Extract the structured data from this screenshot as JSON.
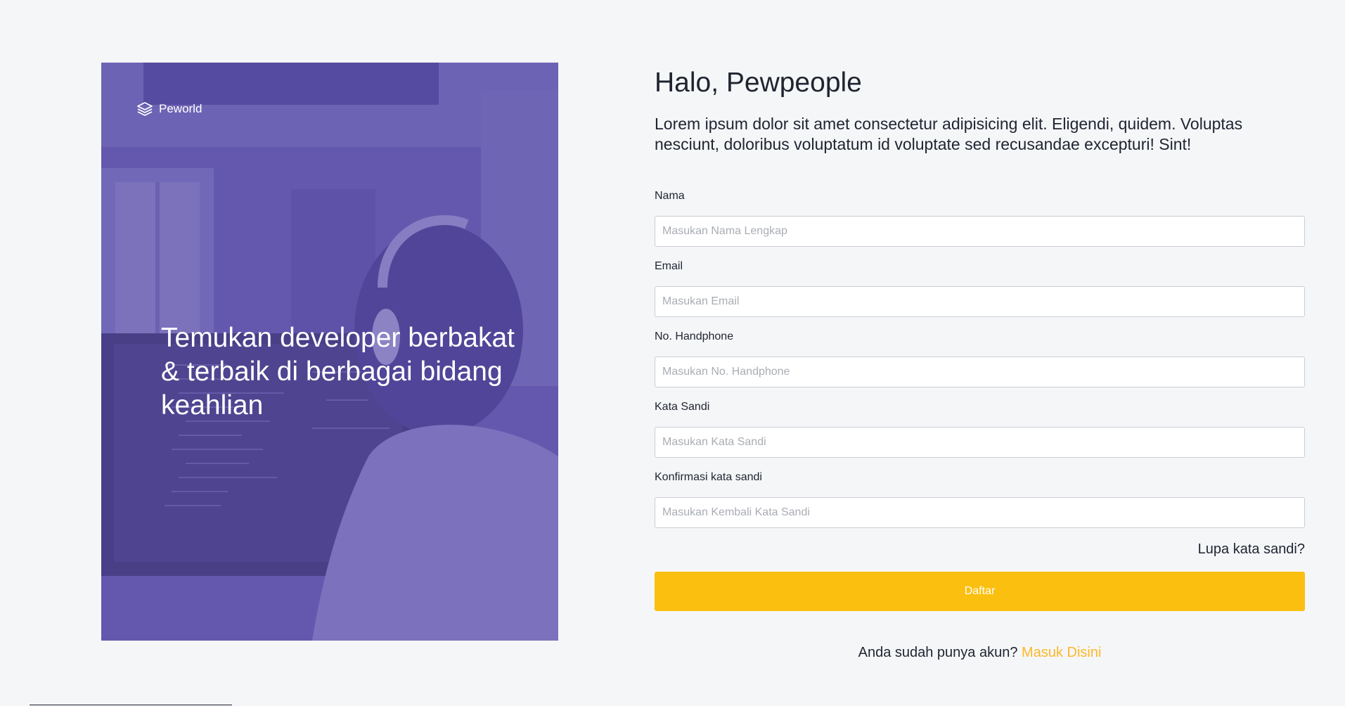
{
  "hero": {
    "brand_name": "Peworld",
    "brand_icon": "stacked-layers-icon",
    "tagline": "Temukan developer berbakat & terbaik di berbagai bidang keahlian",
    "overlay_color": "#5e55a5"
  },
  "form": {
    "title": "Halo, Pewpeople",
    "subtitle": "Lorem ipsum dolor sit amet consectetur adipisicing elit. Eligendi, quidem. Voluptas nesciunt, doloribus voluptatum id voluptate sed recusandae excepturi! Sint!",
    "fields": [
      {
        "label": "Nama",
        "placeholder": "Masukan Nama Lengkap",
        "value": ""
      },
      {
        "label": "Email",
        "placeholder": "Masukan Email",
        "value": ""
      },
      {
        "label": "No. Handphone",
        "placeholder": "Masukan No. Handphone",
        "value": ""
      },
      {
        "label": "Kata Sandi",
        "placeholder": "Masukan Kata Sandi",
        "value": ""
      },
      {
        "label": "Konfirmasi kata sandi",
        "placeholder": "Masukan Kembali Kata Sandi",
        "value": ""
      }
    ],
    "forgot_password": "Lupa kata sandi?",
    "submit_label": "Daftar",
    "login_prompt": "Anda sudah punya akun?",
    "login_link": "Masuk Disini"
  },
  "colors": {
    "accent": "#fbc00f",
    "link": "#fbb829",
    "background": "#f5f6f8"
  }
}
